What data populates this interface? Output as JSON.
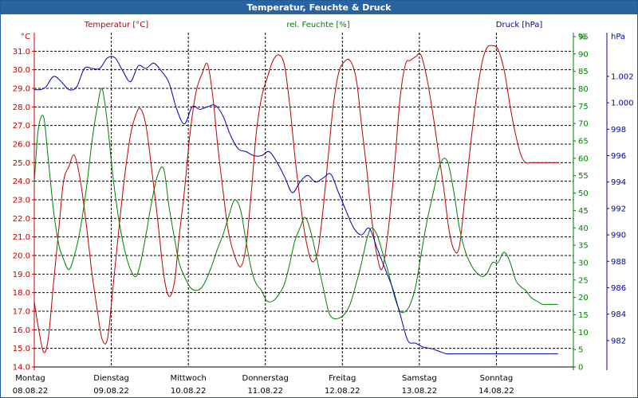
{
  "chart_data": {
    "type": "line",
    "title": "Temperatur, Feuchte & Druck",
    "series_labels": {
      "temperature": "Temperatur [°C]",
      "humidity": "rel. Feuchte [%]",
      "pressure": "Druck [hPa]"
    },
    "axes": {
      "left": {
        "unit": "°C",
        "min": 14.0,
        "max": 32.0,
        "ticks": [
          "31.0",
          "30.0",
          "29.0",
          "28.0",
          "27.0",
          "26.0",
          "25.0",
          "24.0",
          "23.0",
          "22.0",
          "21.0",
          "20.0",
          "19.0",
          "18.0",
          "17.0",
          "16.0",
          "15.0",
          "14.0"
        ]
      },
      "right1": {
        "unit": "%",
        "min": 0,
        "max": 90,
        "ticks": [
          "95",
          "90",
          "85",
          "80",
          "75",
          "70",
          "65",
          "60",
          "55",
          "50",
          "45",
          "40",
          "35",
          "30",
          "25",
          "20",
          "15",
          "10",
          "5",
          "0"
        ]
      },
      "right2": {
        "unit": "hPa",
        "min": 980,
        "max": 1004,
        "ticks": [
          "1.002",
          "1.000",
          "998",
          "996",
          "994",
          "992",
          "990",
          "988",
          "986",
          "984",
          "982"
        ]
      }
    },
    "x_labels": [
      {
        "day": "Montag",
        "date": "08.08.22"
      },
      {
        "day": "Dienstag",
        "date": "09.08.22"
      },
      {
        "day": "Mittwoch",
        "date": "10.08.22"
      },
      {
        "day": "Donnerstag",
        "date": "11.08.22"
      },
      {
        "day": "Freitag",
        "date": "12.08.22"
      },
      {
        "day": "Samstag",
        "date": "13.08.22"
      },
      {
        "day": "Sonntag",
        "date": "14.08.22"
      }
    ],
    "colors": {
      "temperature": "#c00000",
      "humidity": "#008000",
      "pressure": "#0000b0",
      "title_bg": "#2a64a0",
      "grid": "#000000"
    },
    "grid": true,
    "series": [
      {
        "name": "Temperatur [°C]",
        "axis": "left",
        "x": [
          0.0,
          0.05,
          0.12,
          0.18,
          0.25,
          0.32,
          0.38,
          0.45,
          0.52,
          0.6,
          0.68,
          0.75,
          0.82,
          0.88,
          0.95,
          1.02,
          1.1,
          1.18,
          1.25,
          1.32,
          1.38,
          1.45,
          1.52,
          1.6,
          1.68,
          1.75,
          1.82,
          1.88,
          1.95,
          2.02,
          2.1,
          2.18,
          2.25,
          2.32,
          2.38,
          2.45,
          2.52,
          2.6,
          2.68,
          2.75,
          2.82,
          2.88,
          2.95,
          3.02,
          3.1,
          3.18,
          3.25,
          3.32,
          3.38,
          3.45,
          3.52,
          3.6,
          3.68,
          3.75,
          3.82,
          3.88,
          3.95,
          4.02,
          4.1,
          4.18,
          4.25,
          4.32,
          4.38,
          4.45,
          4.52,
          4.6,
          4.68,
          4.75,
          4.82,
          4.88,
          4.95,
          5.02,
          5.1,
          5.18,
          5.25,
          5.32,
          5.38,
          5.45,
          5.52,
          5.6,
          5.68,
          5.75,
          5.82,
          5.88,
          5.95,
          6.02,
          6.1,
          6.18,
          6.25,
          6.32,
          6.38,
          6.45,
          6.52,
          6.6,
          6.68,
          6.75,
          6.8
        ],
        "values": [
          17.5,
          16.2,
          14.8,
          15.5,
          18.5,
          21.5,
          24.0,
          24.8,
          25.4,
          24.0,
          21.5,
          19.0,
          17.0,
          15.5,
          15.5,
          18.2,
          21.5,
          24.5,
          26.5,
          27.6,
          27.9,
          27.0,
          24.8,
          22.0,
          19.0,
          17.8,
          18.6,
          21.0,
          23.5,
          26.5,
          28.8,
          29.8,
          30.3,
          28.5,
          26.0,
          23.5,
          21.3,
          20.0,
          19.4,
          20.5,
          23.5,
          26.5,
          28.5,
          29.5,
          30.5,
          30.8,
          30.2,
          28.0,
          25.5,
          23.0,
          21.0,
          19.7,
          20.2,
          22.5,
          25.5,
          28.0,
          29.8,
          30.4,
          30.5,
          29.5,
          27.0,
          24.5,
          22.0,
          20.0,
          19.3,
          21.5,
          25.0,
          28.5,
          30.3,
          30.5,
          30.7,
          30.8,
          29.5,
          27.5,
          25.5,
          23.5,
          21.5,
          20.3,
          20.5,
          23.5,
          26.5,
          28.8,
          30.5,
          31.2,
          31.3,
          31.1,
          30.0,
          28.0,
          26.5,
          25.4,
          25.0,
          25.0,
          25.0,
          25.0,
          25.0,
          25.0,
          25.0
        ],
        "color": "#c00000"
      },
      {
        "name": "rel. Feuchte [%]",
        "axis": "right1",
        "x": [
          0.0,
          0.05,
          0.12,
          0.18,
          0.25,
          0.32,
          0.38,
          0.45,
          0.52,
          0.6,
          0.68,
          0.75,
          0.82,
          0.88,
          0.95,
          1.02,
          1.1,
          1.18,
          1.25,
          1.32,
          1.38,
          1.45,
          1.52,
          1.6,
          1.68,
          1.75,
          1.82,
          1.88,
          1.95,
          2.02,
          2.1,
          2.18,
          2.25,
          2.32,
          2.38,
          2.45,
          2.52,
          2.6,
          2.68,
          2.75,
          2.82,
          2.88,
          2.95,
          3.02,
          3.1,
          3.18,
          3.25,
          3.32,
          3.38,
          3.45,
          3.52,
          3.6,
          3.68,
          3.75,
          3.82,
          3.88,
          3.95,
          4.02,
          4.1,
          4.18,
          4.25,
          4.32,
          4.38,
          4.45,
          4.52,
          4.6,
          4.68,
          4.75,
          4.82,
          4.88,
          4.95,
          5.02,
          5.1,
          5.18,
          5.25,
          5.32,
          5.38,
          5.45,
          5.52,
          5.6,
          5.68,
          5.75,
          5.82,
          5.88,
          5.95,
          6.02,
          6.1,
          6.18,
          6.25,
          6.32,
          6.38,
          6.45,
          6.52,
          6.6,
          6.68,
          6.75,
          6.8
        ],
        "values": [
          53,
          68,
          72,
          60,
          45,
          35,
          31,
          28,
          32,
          40,
          52,
          65,
          75,
          80,
          70,
          55,
          42,
          33,
          28,
          26,
          30,
          38,
          47,
          55,
          57,
          46,
          37,
          30,
          26,
          23,
          22,
          23,
          26,
          30,
          34,
          38,
          43,
          48,
          45,
          36,
          28,
          24,
          22,
          19,
          19,
          21,
          24,
          30,
          36,
          40,
          43,
          38,
          30,
          23,
          16,
          14,
          14,
          15,
          18,
          24,
          30,
          37,
          40,
          38,
          33,
          27,
          20,
          16,
          16,
          18,
          23,
          32,
          42,
          50,
          57,
          60,
          58,
          50,
          40,
          33,
          29,
          27,
          26,
          27,
          30,
          30,
          33,
          30,
          25,
          23,
          22,
          20,
          19,
          18,
          18,
          18,
          18
        ],
        "color": "#008000"
      },
      {
        "name": "Druck [hPa]",
        "axis": "right2",
        "x": [
          0.0,
          0.08,
          0.15,
          0.25,
          0.35,
          0.45,
          0.55,
          0.65,
          0.75,
          0.85,
          0.95,
          1.05,
          1.15,
          1.25,
          1.35,
          1.45,
          1.55,
          1.65,
          1.75,
          1.85,
          1.95,
          2.05,
          2.15,
          2.25,
          2.35,
          2.45,
          2.55,
          2.65,
          2.75,
          2.85,
          2.95,
          3.05,
          3.15,
          3.25,
          3.35,
          3.45,
          3.55,
          3.65,
          3.75,
          3.85,
          3.95,
          4.05,
          4.15,
          4.25,
          4.35,
          4.45,
          4.55,
          4.65,
          4.75,
          4.85,
          4.95,
          5.05,
          5.15,
          5.25,
          5.35,
          5.45,
          5.55,
          5.65,
          5.75,
          5.85,
          5.95,
          6.05,
          6.15,
          6.25,
          6.35,
          6.45,
          6.55,
          6.65,
          6.75,
          6.8
        ],
        "values": [
          1001.0,
          1001.0,
          1001.2,
          1002.0,
          1001.6,
          1001.0,
          1001.2,
          1002.6,
          1002.6,
          1002.6,
          1003.4,
          1003.4,
          1002.4,
          1001.6,
          1002.8,
          1002.6,
          1003.0,
          1002.4,
          1001.5,
          999.5,
          998.4,
          999.7,
          999.5,
          999.7,
          999.8,
          999.0,
          997.5,
          996.5,
          996.3,
          996.0,
          996.0,
          996.3,
          995.5,
          994.4,
          993.2,
          994.0,
          994.5,
          994.0,
          994.3,
          994.6,
          993.2,
          991.8,
          990.5,
          990.0,
          990.5,
          989.0,
          987.5,
          986.0,
          984.0,
          982.0,
          981.8,
          981.5,
          981.4,
          981.2,
          981.0,
          981.0,
          981.0,
          981.0,
          981.0,
          981.0,
          981.0,
          981.0,
          981.0,
          981.0,
          981.0,
          981.0,
          981.0,
          981.0,
          981.0,
          981.0
        ],
        "color": "#0000b0"
      }
    ]
  }
}
